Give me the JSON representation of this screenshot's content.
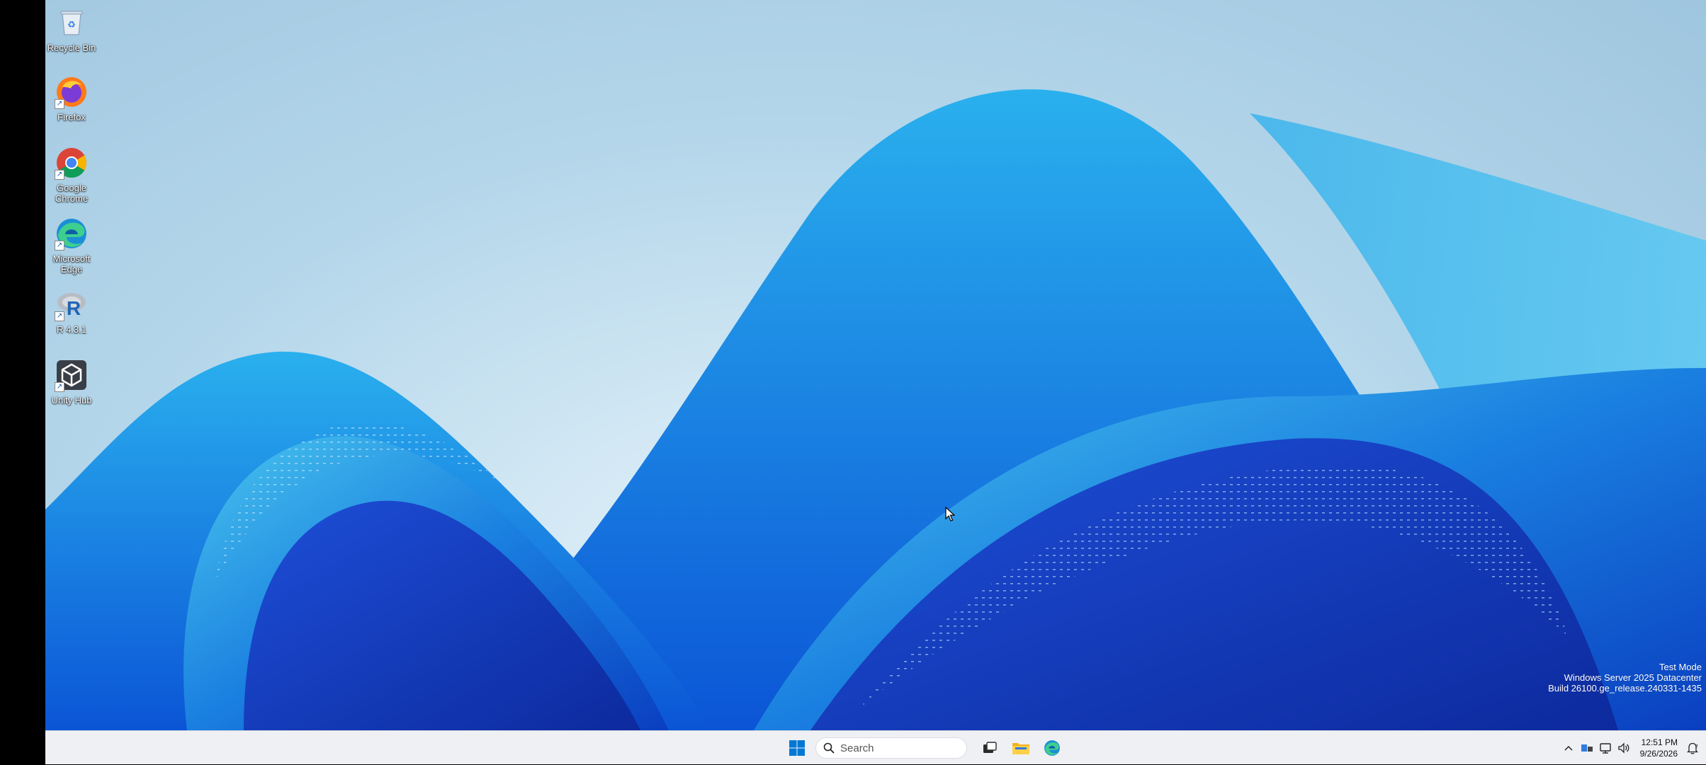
{
  "desktop": {
    "icons": [
      {
        "label": "Recycle Bin",
        "icon": "recycle-bin-icon"
      },
      {
        "label": "Firefox",
        "icon": "firefox-icon"
      },
      {
        "label": "Google Chrome",
        "icon": "chrome-icon"
      },
      {
        "label": "Microsoft Edge",
        "icon": "edge-icon"
      },
      {
        "label": "R 4.3.1",
        "icon": "r-icon"
      },
      {
        "label": "Unity Hub",
        "icon": "unity-hub-icon"
      }
    ],
    "watermark": {
      "line1": "Test Mode",
      "line2": "Windows Server 2025 Datacenter",
      "line3": "Build 26100.ge_release.240331-1435"
    }
  },
  "taskbar": {
    "search": {
      "placeholder": "Search"
    },
    "pinned": [
      {
        "icon": "start-icon"
      },
      {
        "icon": "task-view-icon"
      },
      {
        "icon": "file-explorer-icon"
      },
      {
        "icon": "edge-icon"
      }
    ],
    "tray": {
      "icons": [
        "chevron-up-icon",
        "network-status-icon",
        "network-icon",
        "volume-icon"
      ],
      "time": "12:51 PM",
      "date": "9/26/2026"
    }
  },
  "colors": {
    "taskbar_bg": "#eef0f3",
    "accent": "#0078d4"
  }
}
